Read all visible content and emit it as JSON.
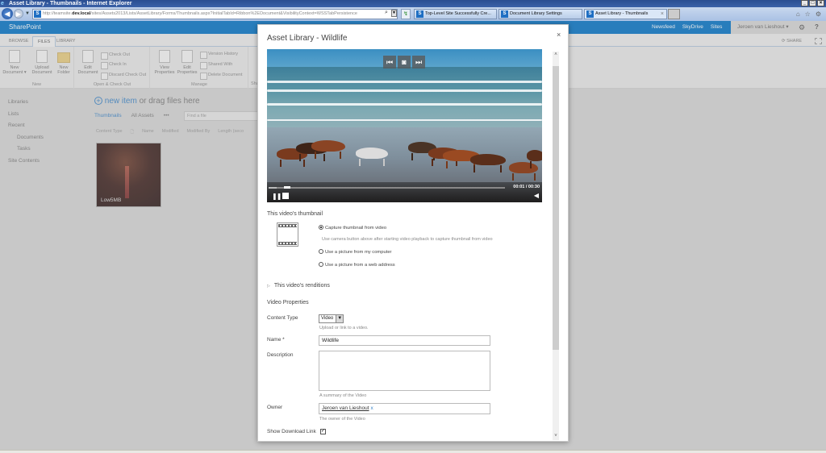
{
  "browser": {
    "window_title": "Asset Library - Thumbnails - Internet Explorer",
    "window_buttons": [
      "_",
      "□",
      "×"
    ],
    "address_prefix": "http://teamsite.",
    "address_host": "dev.local",
    "address_path": "/sites/Assets2013/Lists/AssetLibrary/Forms/Thumbnails.aspx?InitialTabId=Ribbon%2EDocument&VisibilityContext=WSSTabPersistence",
    "tabs": [
      {
        "label": "Top-Level Site Successfully Cre..."
      },
      {
        "label": "Document Library Settings"
      },
      {
        "label": "Asset Library - Thumbnails",
        "active": true
      }
    ],
    "tab_close": "×",
    "tools": [
      "⌂",
      "☆",
      "⚙"
    ]
  },
  "suitebar": {
    "brand": "SharePoint",
    "links": [
      "Newsfeed",
      "SkyDrive",
      "Sites"
    ],
    "active_link": "Sites",
    "user": "Jeroen van Lieshout ▾",
    "gear": "⚙",
    "help": "?"
  },
  "ribbon": {
    "tabs": [
      "BROWSE",
      "FILES",
      "LIBRARY"
    ],
    "active_tab": "FILES",
    "share": "SHARE",
    "groups": {
      "new": {
        "label": "New",
        "buttons": [
          "New Document ▾",
          "Upload Document",
          "New Folder"
        ]
      },
      "open": {
        "label": "Open & Check Out",
        "large": "Edit Document",
        "small": [
          "Check Out",
          "Check In",
          "Discard Check Out"
        ]
      },
      "manage": {
        "label": "Manage",
        "large": [
          "View Properties",
          "Edit Properties"
        ],
        "small": [
          "Version History",
          "Shared With",
          "Delete Document"
        ]
      },
      "share_truncated": "Sha"
    }
  },
  "leftnav": {
    "items": [
      "Libraries",
      "Lists",
      "Recent",
      "Documents",
      "Tasks",
      "Site Contents"
    ]
  },
  "library": {
    "new_item_link": "new item",
    "new_item_rest": " or drag files here",
    "views": [
      "Thumbnails",
      "All Assets",
      "•••"
    ],
    "active_view": "Thumbnails",
    "find_placeholder": "Find a file",
    "columns": [
      "Content Type",
      "Name",
      "Modified",
      "Modified By",
      "Length (seco"
    ],
    "thumb_caption": "Low5MB"
  },
  "dialog": {
    "title": "Asset Library - Wildlife",
    "close": "×",
    "video": {
      "time": "00:01 / 00:30",
      "progress_fraction": 0.033,
      "controls_top": [
        "⏮",
        "📷",
        "⏭"
      ],
      "pause": "❚❚",
      "volume": "◀"
    },
    "thumbnail_section": {
      "title": "This video's thumbnail",
      "options": [
        {
          "label": "Capture thumbnail from video",
          "checked": true
        },
        {
          "label": "Use a picture from my computer",
          "checked": false
        },
        {
          "label": "Use a picture from a web address",
          "checked": false
        }
      ],
      "hint": "Use camera button above after starting video playback to capture thumbnail from video"
    },
    "renditions": "This video's renditions",
    "properties": {
      "title": "Video Properties",
      "content_type_label": "Content Type",
      "content_type_value": "Video",
      "content_type_hint": "Upload or link to a video.",
      "name_label": "Name *",
      "name_value": "Wildlife",
      "description_label": "Description",
      "description_value": "",
      "description_hint": "A summary of the Video",
      "owner_label": "Owner",
      "owner_value": "Jeroen van Lieshout",
      "owner_remove": "x",
      "owner_hint": "The owner of the Video",
      "download_label": "Show Download Link",
      "download_checked": true
    },
    "scroll_up": "˄",
    "scroll_down": "˅"
  }
}
